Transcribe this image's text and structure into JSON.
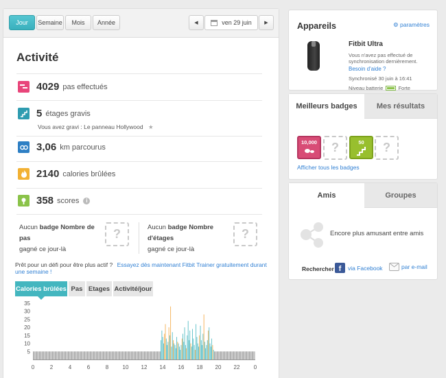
{
  "period_tabs": [
    "Jour",
    "Semaine",
    "Mois",
    "Année"
  ],
  "date_nav": {
    "label": "ven 29 juin",
    "prev": "◀",
    "next": "▶"
  },
  "activity": {
    "title": "Activité",
    "steps": {
      "value": "4029",
      "unit": "pas effectués"
    },
    "floors": {
      "value": "5",
      "unit": "étages gravis",
      "note": "Vous avez gravi : Le panneau Hollywood"
    },
    "distance": {
      "value": "3,06",
      "unit": "km parcourus"
    },
    "calories": {
      "value": "2140",
      "unit": "calories brûlées"
    },
    "scores": {
      "value": "358",
      "unit": "scores"
    }
  },
  "badges_today": {
    "left": {
      "prefix": "Aucun",
      "badge": "badge Nombre de pas",
      "suffix": "gagné ce jour-là"
    },
    "right": {
      "prefix": "Aucun",
      "badge": "badge Nombre d'étages",
      "suffix": "gagné ce jour-là"
    },
    "placeholder": "?"
  },
  "trainer": {
    "text": "Prêt pour un défi pour être plus actif ?",
    "link": "Essayez dès maintenant Fitbit Trainer gratuitement durant une semaine !"
  },
  "chart_tabs": [
    "Calories brûlées",
    "Pas",
    "Etages",
    "Activité/jour"
  ],
  "devices": {
    "title": "Appareils",
    "settings": "paramètres",
    "name": "Fitbit Ultra",
    "warning": "Vous n'avez pas effectué de synchronisation dernièrement.",
    "help": "Besoin d'aide ?",
    "sync": "Synchronisé 30 juin à 16:41",
    "battery_label": "Niveau batterie",
    "battery": "Forte"
  },
  "badges_panel": {
    "tab_active": "Meilleurs badges",
    "tab_other": "Mes résultats",
    "badge1": "10,000",
    "badge2": "50",
    "link": "Afficher tous les badges"
  },
  "friends": {
    "tab_active": "Amis",
    "tab_other": "Groupes",
    "tagline": "Encore plus amusant entre amis",
    "search": "Rechercher",
    "facebook": "via Facebook",
    "email": "par e-mail"
  },
  "colors": {
    "accent": "#43b6bf",
    "steps": "#e8457a",
    "floors": "#2f9cb0",
    "distance": "#2e7fc4",
    "calories": "#f2b134",
    "scores": "#8bc34a",
    "gray_bar": "#9a9a9a",
    "orange_bar": "#f3a43a"
  },
  "chart_data": {
    "type": "bar",
    "y_ticks": [
      "35",
      "30",
      "25",
      "20",
      "15",
      "10",
      "5"
    ],
    "x_ticks": [
      "0",
      "2",
      "4",
      "6",
      "8",
      "10",
      "12",
      "14",
      "16",
      "18",
      "20",
      "22",
      "0"
    ],
    "ylim": [
      0,
      35
    ],
    "series": [
      {
        "values": [
          5,
          5,
          5,
          5,
          5,
          5,
          5,
          5,
          5,
          5,
          5,
          5,
          5,
          5,
          5,
          5,
          5,
          5,
          5,
          5,
          5,
          5,
          5,
          5,
          5,
          5,
          5,
          5,
          5,
          5,
          5,
          5,
          5,
          5,
          5,
          5,
          5,
          5,
          5,
          5,
          5,
          5,
          5,
          5,
          5,
          5,
          5,
          5,
          5,
          5,
          5,
          5,
          5,
          5,
          5,
          5,
          5,
          5,
          5,
          5,
          5,
          5,
          5,
          5,
          5,
          5,
          5,
          5,
          5,
          5,
          5,
          5,
          5,
          5,
          5,
          5,
          5,
          5,
          5,
          5,
          5,
          5,
          5,
          5,
          5,
          5,
          5,
          5,
          5,
          5,
          5,
          5,
          5,
          5,
          5,
          5,
          5,
          5,
          5,
          5,
          5,
          5,
          5,
          5,
          5,
          5,
          5,
          5,
          5,
          5,
          5,
          5,
          5,
          5,
          5,
          5,
          5,
          5,
          5,
          5,
          5,
          5,
          5,
          5,
          5,
          5,
          5,
          5,
          5,
          5,
          5,
          5,
          5,
          5,
          5,
          5,
          5,
          5,
          5,
          5,
          5,
          5,
          5,
          5,
          5,
          5,
          12,
          18,
          14,
          10,
          16,
          22,
          13,
          9,
          11,
          20,
          15,
          33,
          8,
          17,
          12,
          10,
          9,
          7,
          14,
          11,
          10,
          8,
          6,
          9,
          13,
          16,
          11,
          20,
          9,
          7,
          15,
          24,
          12,
          18,
          10,
          8,
          19,
          13,
          9,
          6,
          22,
          14,
          10,
          8,
          15,
          21,
          12,
          9,
          16,
          28,
          11,
          7,
          9,
          12,
          18,
          20,
          10,
          8,
          13,
          9,
          6,
          5,
          5,
          5,
          5,
          5,
          5,
          5,
          5,
          5,
          5,
          5,
          5,
          5,
          5,
          5,
          5,
          5,
          5,
          5,
          5,
          5,
          5,
          5,
          5,
          5,
          5,
          5,
          5,
          5,
          5,
          5,
          5,
          5,
          5,
          5,
          5,
          5,
          5,
          5,
          5,
          5,
          5,
          5,
          5,
          5,
          5,
          5
        ]
      }
    ]
  }
}
